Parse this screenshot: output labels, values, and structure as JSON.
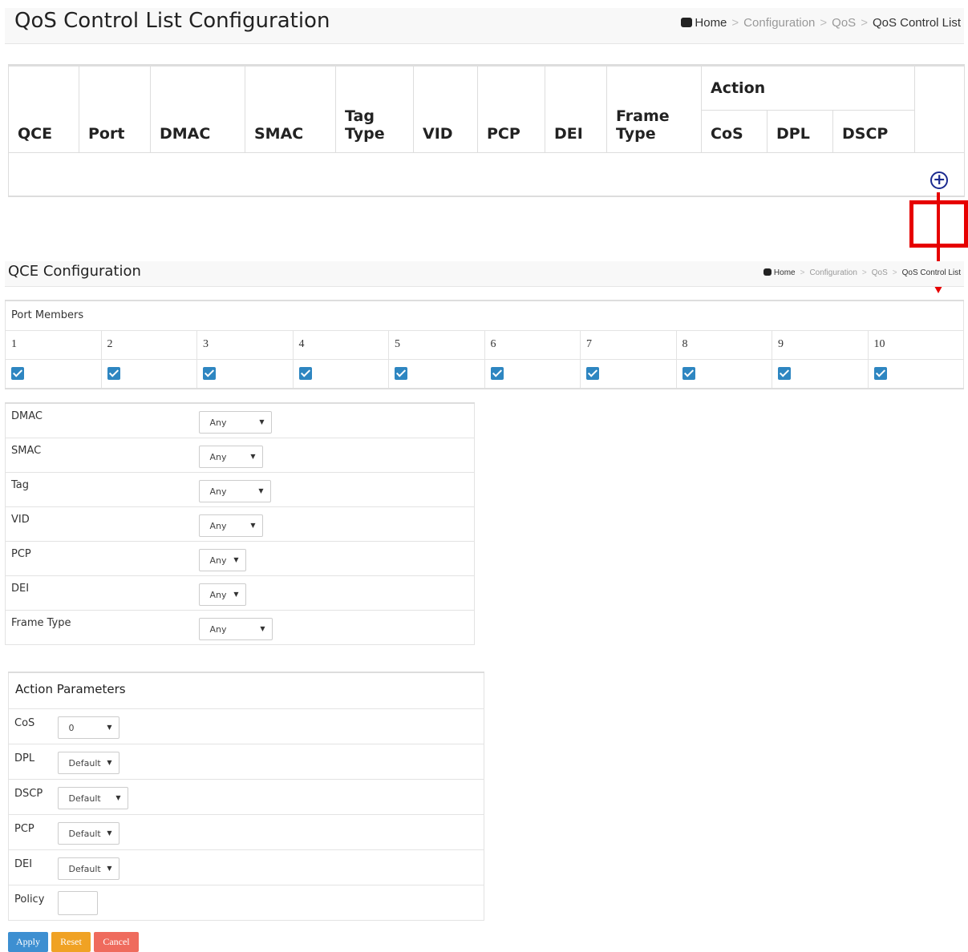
{
  "top": {
    "title": "QoS Control List Configuration",
    "breadcrumb": [
      "Home",
      "Configuration",
      "QoS",
      "QoS Control List"
    ],
    "columns": {
      "qce": "QCE",
      "port": "Port",
      "dmac": "DMAC",
      "smac": "SMAC",
      "tag_type_1": "Tag",
      "tag_type_2": "Type",
      "vid": "VID",
      "pcp": "PCP",
      "dei": "DEI",
      "frame_type_1": "Frame",
      "frame_type_2": "Type",
      "action": "Action",
      "cos": "CoS",
      "dpl": "DPL",
      "dscp": "DSCP"
    },
    "add_icon": "plus-circle-icon"
  },
  "qce_config": {
    "title": "QCE Configuration",
    "breadcrumb": [
      "Home",
      "Configuration",
      "QoS",
      "QoS Control List"
    ],
    "port_members": {
      "title": "Port Members",
      "ports": [
        "1",
        "2",
        "3",
        "4",
        "5",
        "6",
        "7",
        "8",
        "9",
        "10"
      ],
      "checked": [
        true,
        true,
        true,
        true,
        true,
        true,
        true,
        true,
        true,
        true
      ]
    },
    "filters": [
      {
        "label": "DMAC",
        "value": "Any"
      },
      {
        "label": "SMAC",
        "value": "Any"
      },
      {
        "label": "Tag",
        "value": "Any"
      },
      {
        "label": "VID",
        "value": "Any"
      },
      {
        "label": "PCP",
        "value": "Any"
      },
      {
        "label": "DEI",
        "value": "Any"
      },
      {
        "label": "Frame Type",
        "value": "Any"
      }
    ],
    "action_parameters": {
      "title": "Action Parameters",
      "rows": [
        {
          "label": "CoS",
          "value": "0"
        },
        {
          "label": "DPL",
          "value": "Default"
        },
        {
          "label": "DSCP",
          "value": "Default"
        },
        {
          "label": "PCP",
          "value": "Default"
        },
        {
          "label": "DEI",
          "value": "Default"
        }
      ],
      "policy_label": "Policy",
      "policy_value": ""
    },
    "buttons": {
      "apply": "Apply",
      "reset": "Reset",
      "cancel": "Cancel"
    }
  },
  "colors": {
    "checkbox": "#2e86c1",
    "annotation": "#e60000",
    "apply": "#3d8fd1",
    "reset": "#f0a224",
    "cancel": "#ef6b5d",
    "add_icon": "#1b2a8f"
  }
}
